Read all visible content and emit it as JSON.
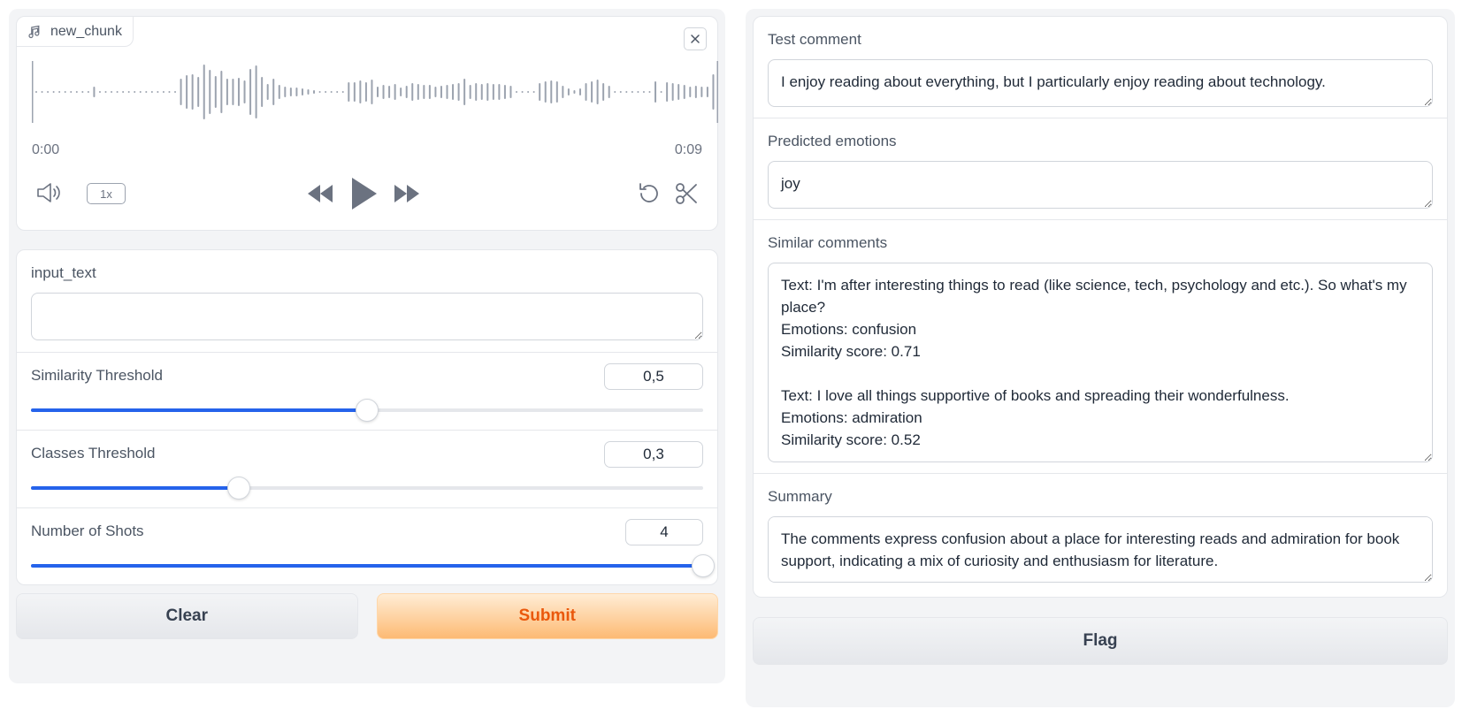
{
  "audio": {
    "file_name": "new_chunk",
    "time_start": "0:00",
    "time_end": "0:09",
    "speed": "1x",
    "bars": [
      2,
      2,
      2,
      2,
      2,
      2,
      2,
      2,
      2,
      2,
      12,
      2,
      2,
      2,
      2,
      2,
      2,
      2,
      2,
      2,
      2,
      2,
      2,
      2,
      2,
      30,
      38,
      40,
      34,
      62,
      50,
      36,
      48,
      30,
      30,
      32,
      26,
      52,
      60,
      34,
      18,
      30,
      16,
      12,
      10,
      10,
      8,
      6,
      4,
      2,
      2,
      2,
      2,
      2,
      22,
      22,
      26,
      22,
      28,
      12,
      16,
      14,
      18,
      10,
      14,
      20,
      18,
      16,
      16,
      12,
      14,
      16,
      18,
      20,
      30,
      16,
      20,
      18,
      20,
      18,
      18,
      16,
      14,
      2,
      2,
      2,
      2,
      20,
      24,
      26,
      24,
      14,
      8,
      4,
      8,
      20,
      24,
      28,
      20,
      14,
      2,
      2,
      2,
      2,
      2,
      2,
      2,
      24,
      2,
      22,
      20,
      18,
      16,
      12,
      14,
      12,
      12,
      40
    ],
    "colors": {
      "wave": "#9ca3af",
      "icon": "#6b7280"
    }
  },
  "inputs": {
    "input_text": {
      "label": "input_text",
      "value": ""
    },
    "similarity": {
      "label": "Similarity Threshold",
      "value": "0,5",
      "fraction": 0.5
    },
    "classes": {
      "label": "Classes Threshold",
      "value": "0,3",
      "fraction": 0.309
    },
    "shots": {
      "label": "Number of Shots",
      "value": "4",
      "fraction": 1.0
    }
  },
  "buttons": {
    "clear": "Clear",
    "submit": "Submit",
    "flag": "Flag"
  },
  "outputs": {
    "test_comment": {
      "label": "Test comment",
      "value": "I enjoy reading about everything, but I particularly enjoy reading about technology."
    },
    "predicted": {
      "label": "Predicted emotions",
      "value": "joy"
    },
    "similar": {
      "label": "Similar comments",
      "value": "Text: I'm after interesting things to read (like science, tech, psychology and etc.). So what's my place?\nEmotions: confusion\nSimilarity score: 0.71\n\nText: I love all things supportive of books and spreading their wonderfulness.\nEmotions: admiration\nSimilarity score: 0.52"
    },
    "summary": {
      "label": "Summary",
      "value": "The comments express confusion about a place for interesting reads and admiration for book support, indicating a mix of curiosity and enthusiasm for literature."
    }
  },
  "accent": "#2563eb"
}
